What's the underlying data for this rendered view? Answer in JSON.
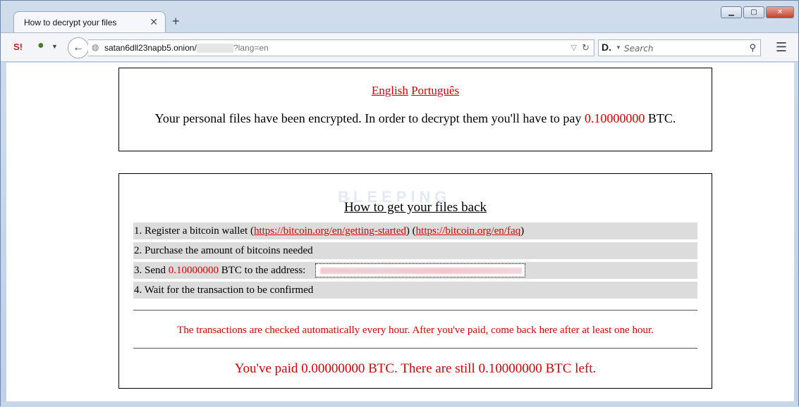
{
  "browser": {
    "tab_title": "How to decrypt your files",
    "tab_close": "✕",
    "new_tab": "+",
    "addon1_label": "S!",
    "url_host": "satan6dll23napb5.onion/",
    "url_query": "?lang=en",
    "search_engine": "D.",
    "search_placeholder": "Search"
  },
  "page": {
    "languages": [
      "English",
      "Português"
    ],
    "intro_before": "Your personal files have been encrypted. In order to decrypt them you'll have to pay",
    "amount": "0.10000000",
    "intro_after": "BTC.",
    "watermark": "BLEEPING",
    "how_title": "How to get your files back",
    "steps": {
      "s1_text": "1. Register a bitcoin wallet (",
      "s1_link1": "https://bitcoin.org/en/getting-started",
      "s1_mid": ") (",
      "s1_link2": "https://bitcoin.org/en/faq",
      "s1_end": ")",
      "s2_text": "2. Purchase the amount of bitcoins needed",
      "s3_before": "3. Send",
      "s3_amount": "0.10000000",
      "s3_after": "BTC to the address:",
      "s4_text": "4. Wait for the transaction to be confirmed"
    },
    "notice": "The transactions are checked automatically every hour. After you've paid, come back here after at least one hour.",
    "paid_status": "You've paid 0.00000000 BTC. There are still 0.10000000 BTC left."
  },
  "colors": {
    "accent_red": "#e00000",
    "step_bg": "#dcdcdc"
  }
}
